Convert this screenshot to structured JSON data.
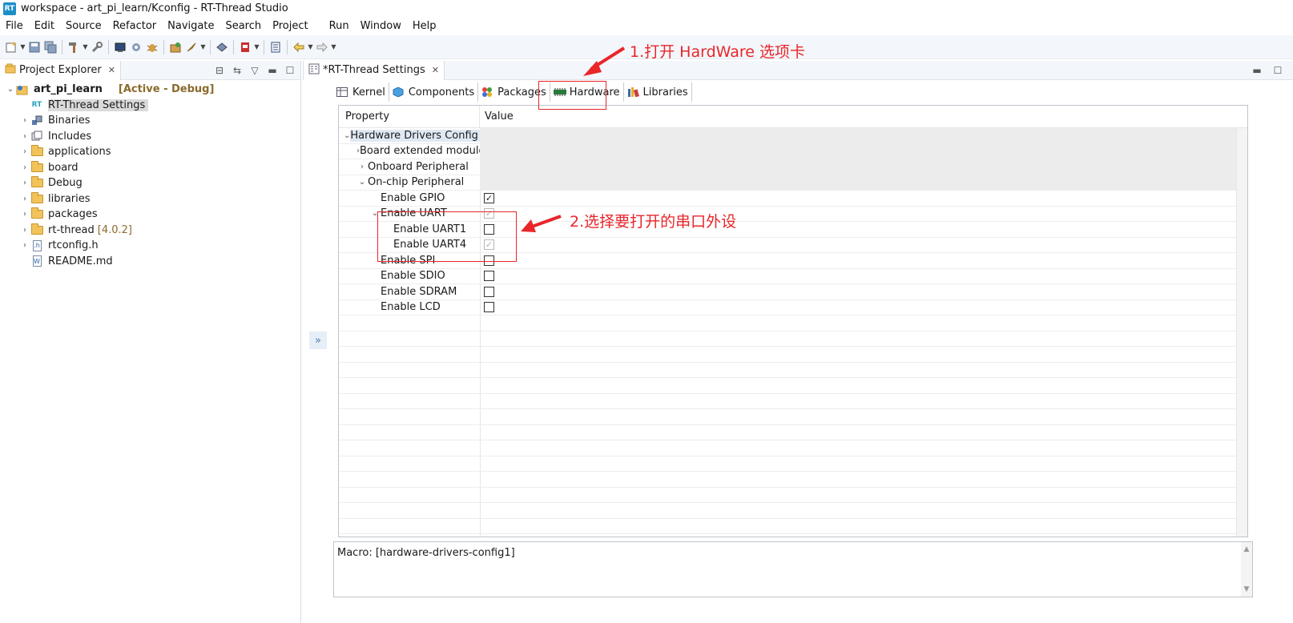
{
  "window": {
    "title": "workspace - art_pi_learn/Kconfig - RT-Thread Studio",
    "logo_text": "RT"
  },
  "menu": [
    {
      "label": "File",
      "underline": "F",
      "rest": "ile"
    },
    {
      "label": "Edit",
      "underline": "E",
      "rest": "dit"
    },
    {
      "label": "Source",
      "underline": "S",
      "rest": "ource"
    },
    {
      "label": "Refactor",
      "underline": "",
      "rest": "Refactor"
    },
    {
      "label": "Navigate",
      "underline": "N",
      "rest": "avigate"
    },
    {
      "label": "Search",
      "underline": "a",
      "pre": "Se",
      "rest": "rch"
    },
    {
      "label": "Project",
      "underline": "P",
      "rest": "roject"
    },
    {
      "label": "Run",
      "underline": "R",
      "rest": "un"
    },
    {
      "label": "Window",
      "underline": "W",
      "rest": "indow"
    },
    {
      "label": "Help",
      "underline": "H",
      "rest": "elp"
    }
  ],
  "project_explorer": {
    "tab_label": "Project Explorer",
    "root": {
      "name": "art_pi_learn",
      "status": "[Active - Debug]"
    },
    "items": [
      {
        "label": "RT-Thread Settings",
        "icon": "rt-icon",
        "expandable": false,
        "selected": true
      },
      {
        "label": "Binaries",
        "icon": "binaries-icon",
        "expandable": true
      },
      {
        "label": "Includes",
        "icon": "includes-icon",
        "expandable": true
      },
      {
        "label": "applications",
        "icon": "folder-icon",
        "expandable": true
      },
      {
        "label": "board",
        "icon": "folder-icon",
        "expandable": true
      },
      {
        "label": "Debug",
        "icon": "folder-icon",
        "expandable": true
      },
      {
        "label": "libraries",
        "icon": "folder-icon",
        "expandable": true
      },
      {
        "label": "packages",
        "icon": "folder-icon",
        "expandable": true
      },
      {
        "label": "rt-thread",
        "icon": "folder-icon",
        "expandable": true,
        "tag": "[4.0.2]"
      },
      {
        "label": "rtconfig.h",
        "icon": "header-file-icon",
        "expandable": true
      },
      {
        "label": "README.md",
        "icon": "markdown-file-icon",
        "expandable": false
      }
    ]
  },
  "editor": {
    "tab_label": "*RT-Thread Settings",
    "sub_tabs": [
      "Kernel",
      "Components",
      "Packages",
      "Hardware",
      "Libraries"
    ],
    "active_sub_tab": "Hardware",
    "columns": {
      "property": "Property",
      "value": "Value"
    },
    "rows": [
      {
        "label": "Hardware Drivers Config",
        "level": 0,
        "chev": "down",
        "group": true,
        "highlight": true
      },
      {
        "label": "Board extended module",
        "level": 1,
        "chev": "right",
        "group": true
      },
      {
        "label": "Onboard Peripheral",
        "level": 1,
        "chev": "right",
        "group": true
      },
      {
        "label": "On-chip Peripheral",
        "level": 1,
        "chev": "down",
        "group": true
      },
      {
        "label": "Enable GPIO",
        "level": 2,
        "checked": true,
        "disabled": false
      },
      {
        "label": "Enable UART",
        "level": 2,
        "chev": "down",
        "checked": true,
        "disabled": true
      },
      {
        "label": "Enable UART1",
        "level": 3,
        "checked": false,
        "disabled": false
      },
      {
        "label": "Enable UART4",
        "level": 3,
        "checked": true,
        "disabled": true
      },
      {
        "label": "Enable SPI",
        "level": 2,
        "checked": false,
        "disabled": false
      },
      {
        "label": "Enable SDIO",
        "level": 2,
        "checked": false,
        "disabled": false
      },
      {
        "label": "Enable SDRAM",
        "level": 2,
        "checked": false,
        "disabled": false
      },
      {
        "label": "Enable LCD",
        "level": 2,
        "checked": false,
        "disabled": false
      }
    ],
    "macro_text": "Macro: [hardware-drivers-config1]"
  },
  "annotations": {
    "step1": "1.打开 HardWare 选项卡",
    "step2": "2.选择要打开的串口外设",
    "color": "#e8262a"
  }
}
